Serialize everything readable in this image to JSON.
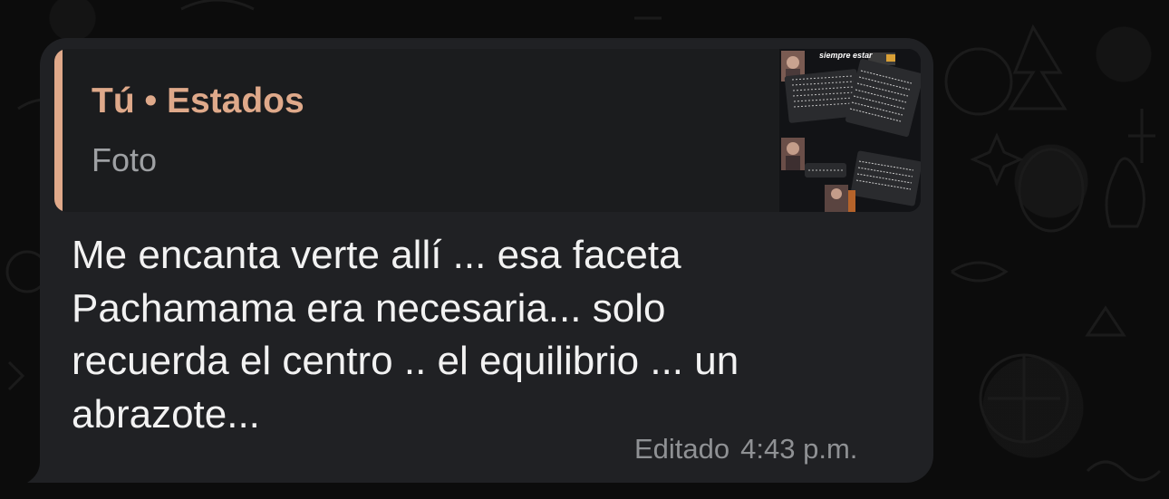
{
  "reply_preview": {
    "author": "Tú • Estados",
    "type": "Foto",
    "thumbnail_caption": "siempre estar"
  },
  "message": {
    "lines": [
      "Me encanta verte allí ... esa faceta",
      "Pachamama era necesaria... solo",
      "recuerda el centro .. el equilibrio ... un",
      "abrazote..."
    ],
    "edited_label": "Editado",
    "time": "4:43 p.m."
  },
  "colors": {
    "bubble": "#202124",
    "quote_background": "#1b1c1e",
    "quote_accent": "#e0a98a",
    "text": "#f2f2f2",
    "meta": "#8f9194"
  }
}
